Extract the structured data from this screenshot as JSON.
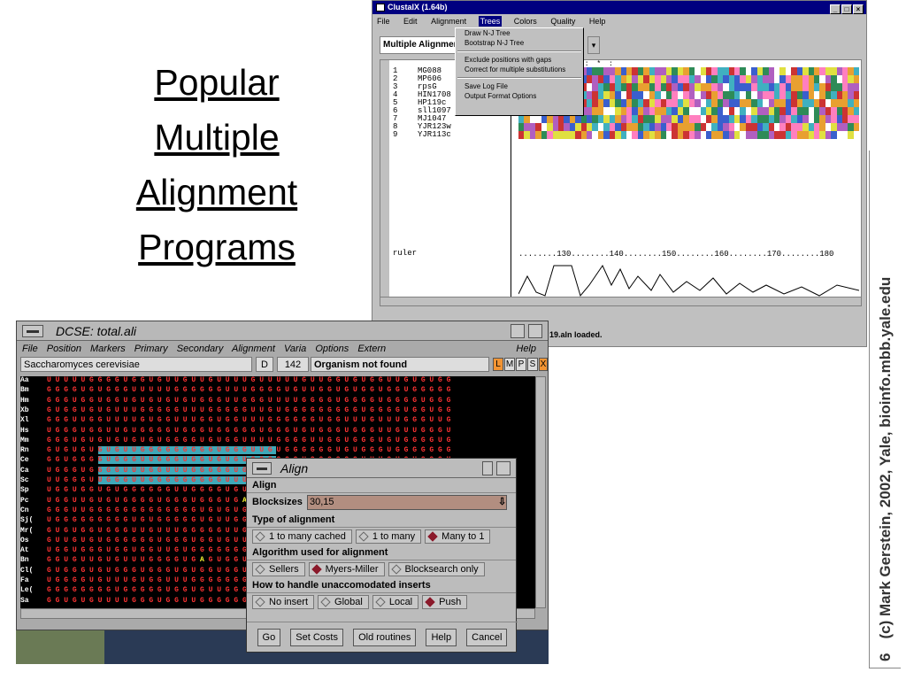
{
  "slide": {
    "title_lines": [
      "Popular",
      "Multiple",
      "Alignment",
      "Programs"
    ],
    "credit": "(c) Mark Gerstein, 2002, Yale, bioinfo.mbb.yale.edu",
    "page_number": "6"
  },
  "clustal": {
    "title": "ClustalX (1.64b)",
    "menu": [
      "File",
      "Edit",
      "Alignment",
      "Trees",
      "Colors",
      "Quality",
      "Help"
    ],
    "active_menu": "Trees",
    "mode": "Multiple Alignment Mode",
    "sequences": [
      {
        "num": "1",
        "name": "MG088"
      },
      {
        "num": "2",
        "name": "MP606"
      },
      {
        "num": "3",
        "name": "rpsG"
      },
      {
        "num": "4",
        "name": "HIN1708"
      },
      {
        "num": "5",
        "name": "HP119c"
      },
      {
        "num": "6",
        "name": "sll1097"
      },
      {
        "num": "7",
        "name": "MJ1047"
      },
      {
        "num": "8",
        "name": "YJR123w"
      },
      {
        "num": "9",
        "name": "YJR113c"
      }
    ],
    "ruler_label": "ruler",
    "ruler_ticks": "........130........140........150........160........170........180",
    "status": "19.aln loaded.",
    "trees_menu": {
      "group1": [
        "Draw N-J Tree",
        "Bootstrap N-J Tree"
      ],
      "group2": [
        "Exclude positions with gaps",
        "Correct for multiple substitutions"
      ],
      "group3": [
        "Save Log File",
        "Output Format Options"
      ]
    }
  },
  "dcse": {
    "title": "DCSE: total.ali",
    "menu": [
      "File",
      "Position",
      "Markers",
      "Primary",
      "Secondary",
      "Alignment",
      "Varia",
      "Options",
      "Extern"
    ],
    "help": "Help",
    "organism": "Saccharomyces cerevisiae",
    "field_d": "D",
    "position": "142",
    "message": "Organism not found",
    "letter_buttons": [
      "L",
      "M",
      "P",
      "S",
      "X"
    ],
    "rows": [
      "Aa",
      "Bm",
      "Hm",
      "Xb",
      "Xl",
      "Hs",
      "Mm",
      "Rn",
      "Ce",
      "Ca",
      "Sc",
      "Sp",
      "Pc",
      "Cn",
      "Sj(",
      "Mr(",
      "Os",
      "At",
      "Bn",
      "Cl(",
      "Fa",
      "Le(",
      "Sa"
    ]
  },
  "align": {
    "title": "Align",
    "section": "Align",
    "blocksizes_label": "Blocksizes",
    "blocksizes_value": "30,15",
    "type_heading": "Type of alignment",
    "type_options": [
      "1 to many cached",
      "1 to many",
      "Many to 1"
    ],
    "algo_heading": "Algorithm used for alignment",
    "algo_options": [
      "Sellers",
      "Myers-Miller",
      "Blocksearch only"
    ],
    "inserts_heading": "How to handle unaccomodated inserts",
    "insert_options": [
      "No insert",
      "Global",
      "Local",
      "Push"
    ],
    "buttons": [
      "Go",
      "Set Costs",
      "Old routines",
      "Help",
      "Cancel"
    ]
  }
}
